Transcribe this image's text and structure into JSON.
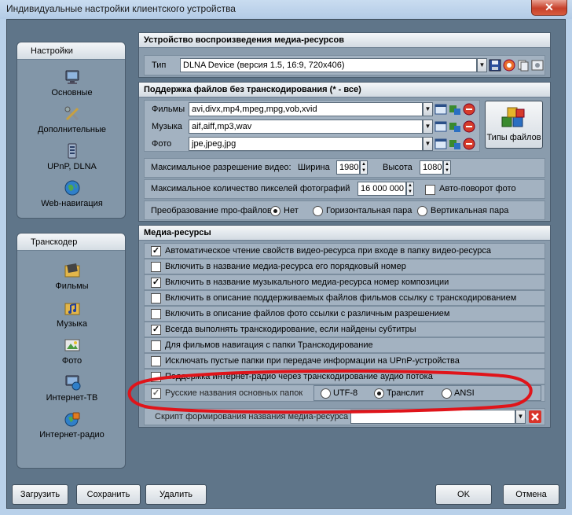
{
  "window": {
    "title": "Индивидуальные настройки клиентского устройства",
    "close": "✕"
  },
  "nav": {
    "settings": {
      "header": "Настройки",
      "items": [
        "Основные",
        "Дополнительные",
        "UPnP, DLNA",
        "Web-навигация"
      ]
    },
    "transcoder": {
      "header": "Транскодер",
      "items": [
        "Фильмы",
        "Музыка",
        "Фото",
        "Интернет-ТВ",
        "Интернет-радио"
      ]
    }
  },
  "device": {
    "header": "Устройство воспроизведения медиа-ресурсов",
    "type_label": "Тип",
    "type_value": "DLNA Device (версия 1.5, 16:9, 720x406)"
  },
  "files": {
    "header": "Поддержка файлов без транскодирования (* - все)",
    "films_label": "Фильмы",
    "films_value": "avi,divx,mp4,mpeg,mpg,vob,xvid",
    "music_label": "Музыка",
    "music_value": "aif,aiff,mp3,wav",
    "photo_label": "Фото",
    "photo_value": "jpe,jpeg,jpg",
    "types_button": "Типы файлов",
    "max_res_label": "Максимальное разрешение видео:",
    "width_label": "Ширина",
    "width_value": "1980",
    "height_label": "Высота",
    "height_value": "1080",
    "max_pixels_label": "Максимальное количество пикселей фотографий",
    "max_pixels_value": "16 000 000",
    "autorotate_label": "Авто-поворот фото",
    "mpo_label": "Преобразование mpo-файлов",
    "mpo_options": [
      "Нет",
      "Горизонтальная пара",
      "Вертикальная пара"
    ],
    "mpo_selected": 0
  },
  "media": {
    "header": "Медиа-ресурсы",
    "options": [
      {
        "label": "Автоматическое чтение свойств видео-ресурса при входе в папку видео-ресурса",
        "checked": true
      },
      {
        "label": "Включить в название медиа-ресурса его порядковый номер",
        "checked": false
      },
      {
        "label": "Включить в название музыкального медиа-ресурса номер композиции",
        "checked": true
      },
      {
        "label": "Включить в описание поддерживаемых файлов фильмов ссылку с транскодированием",
        "checked": false
      },
      {
        "label": "Включить в описание файлов фото ссылки с различным разрешением",
        "checked": false
      },
      {
        "label": "Всегда выполнять транскодирование, если найдены субтитры",
        "checked": true
      },
      {
        "label": "Для фильмов навигация с папки Транскодирование",
        "checked": false
      },
      {
        "label": "Исключать пустые папки при передаче информации на  UPnP-устройства",
        "checked": false
      },
      {
        "label": "Поддержка интернет-радио через транскодирование аудио потока",
        "checked": false
      }
    ],
    "russian_names_label": "Русские названия основных папок",
    "russian_names_checked": true,
    "encoding_options": [
      "UTF-8",
      "Транслит",
      "ANSI"
    ],
    "encoding_selected": 1,
    "script_label": "Скрипт формирования названия медиа-ресурса"
  },
  "buttons": {
    "load": "Загрузить",
    "save": "Сохранить",
    "delete": "Удалить",
    "ok": "OK",
    "cancel": "Отмена"
  },
  "colors": {
    "highlight_ring": "#e0141a",
    "panel_bg": "#8a9cad",
    "client_bg": "#5f7589"
  }
}
